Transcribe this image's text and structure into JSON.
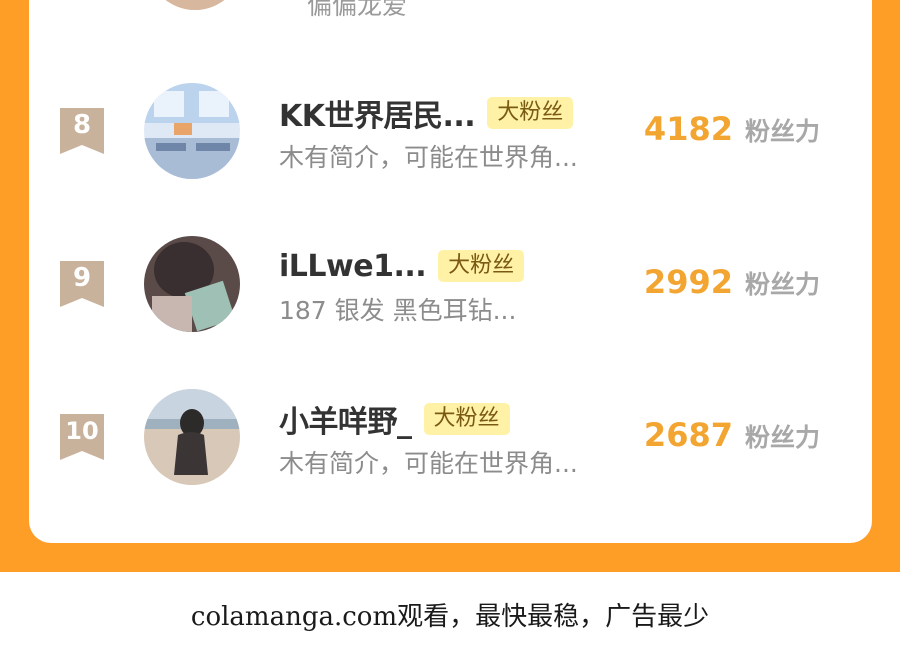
{
  "previous_row": {
    "bio_fragment": "偏偏龙爱"
  },
  "rows": [
    {
      "rank": "8",
      "name": "KK世界居民...",
      "tag": "大粉丝",
      "bio": "木有简介，可能在世界角...",
      "power_value": "4182",
      "power_unit": "粉丝力"
    },
    {
      "rank": "9",
      "name": "iLLwe1...",
      "tag": "大粉丝",
      "bio": "187 银发 黑色耳钻...",
      "power_value": "2992",
      "power_unit": "粉丝力"
    },
    {
      "rank": "10",
      "name": "小羊咩野_",
      "tag": "大粉丝",
      "bio": "木有简介，可能在世界角...",
      "power_value": "2687",
      "power_unit": "粉丝力"
    }
  ],
  "footer": {
    "ad_text": "colamanga.com观看，最快最稳，广告最少"
  },
  "colors": {
    "background_orange": "#ff9e27",
    "power_value": "#f3a531",
    "rank_badge": "#c9b29b",
    "tag_background": "#fff2a6"
  }
}
